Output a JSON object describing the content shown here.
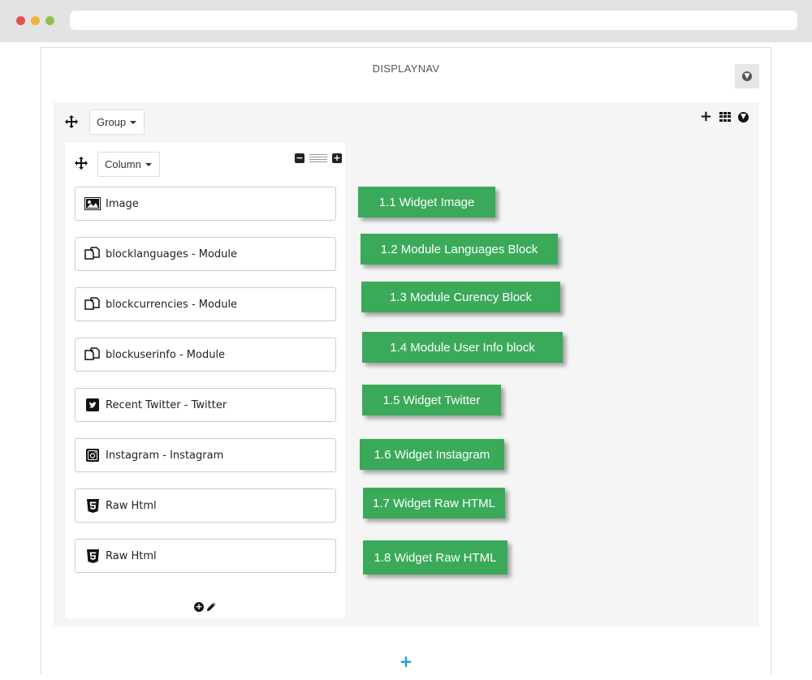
{
  "hook": {
    "title": "DISPLAYNAV"
  },
  "group": {
    "dropdown_label": "Group"
  },
  "column": {
    "dropdown_label": "Column"
  },
  "widgets": [
    {
      "label": "Image",
      "icon": "image-icon"
    },
    {
      "label": "blocklanguages - Module",
      "icon": "module-icon"
    },
    {
      "label": "blockcurrencies - Module",
      "icon": "module-icon"
    },
    {
      "label": "blockuserinfo - Module",
      "icon": "module-icon"
    },
    {
      "label": "Recent Twitter - Twitter",
      "icon": "twitter-icon"
    },
    {
      "label": "Instagram - Instagram",
      "icon": "instagram-icon"
    },
    {
      "label": "Raw Html",
      "icon": "html5-icon"
    },
    {
      "label": "Raw Html",
      "icon": "html5-icon"
    }
  ],
  "callouts": [
    "1.1 Widget Image",
    "1.2 Module Languages Block",
    "1.3 Module Curency Block",
    "1.4 Module User Info block",
    "1.5 Widget Twitter",
    "1.6 Widget Instagram",
    "1.7 Widget Raw HTML",
    "1.8 Widget Raw HTML"
  ],
  "colors": {
    "callout_green": "#3aaa5a",
    "add_row_blue": "#1aa0d8"
  }
}
